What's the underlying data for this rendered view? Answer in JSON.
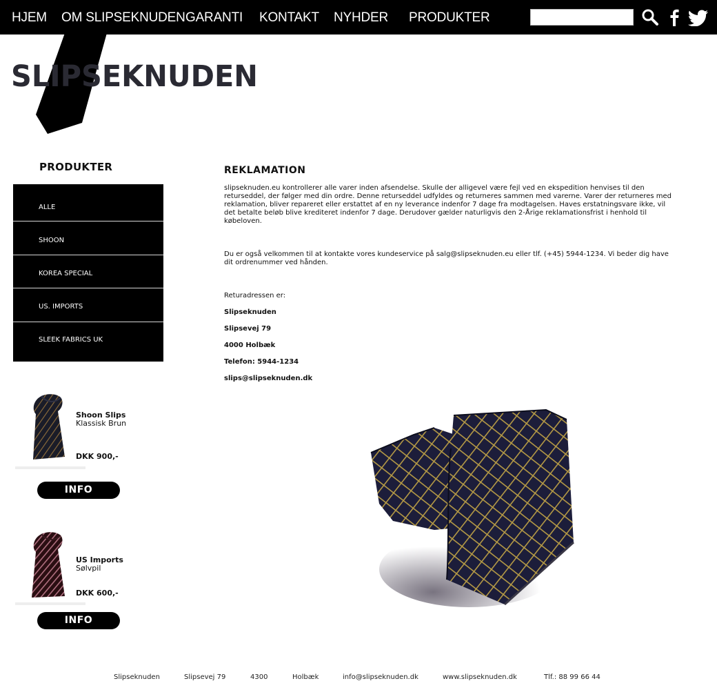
{
  "nav": {
    "items": [
      "HJEM",
      "OM SLIPSEKNUDEN",
      "GARANTI",
      "KONTAKT",
      "NYHDER",
      "PRODUKTER"
    ],
    "search_value": ""
  },
  "icons": {
    "search": "search-icon",
    "facebook": "facebook-icon",
    "twitter": "twitter-icon"
  },
  "logo": {
    "text": "SLIPSEKNUDEN"
  },
  "sidebar": {
    "heading": "PRODUKTER",
    "items": [
      "ALLE",
      "SHOON",
      "KOREA SPECIAL",
      "US. IMPORTS",
      "SLEEK FABRICS UK"
    ]
  },
  "products": [
    {
      "name": "Shoon Slips",
      "subtitle": "Klassisk Brun",
      "price": "DKK 900,-",
      "button": "INFO"
    },
    {
      "name": "US Imports",
      "subtitle": "Sølvpil",
      "price": "DKK 600,-",
      "button": "INFO"
    }
  ],
  "main": {
    "title": "REKLAMATION",
    "paragraph1": "slipseknuden.eu kontrollerer alle varer inden afsendelse. Skulle der alligevel være fejl ved en ekspedition henvises til den returseddel, der følger med din ordre. Denne returseddel udfyldes og returneres sammen med varerne. Varer der returneres med reklamation, bliver repareret eller erstattet af en ny leverance indenfor 7 dage fra modtagelsen. Haves erstatningsvare ikke, vil det betalte beløb blive krediteret indenfor 7 dage. Derudover gælder naturligvis den 2-Årige reklamationsfrist i henhold til købeloven.",
    "paragraph2": "Du er også velkommen til at kontakte vores kundeservice på salg@slipseknuden.eu eller tlf. (+45) 5944-1234. Vi beder dig have dit ordrenummer ved hånden.",
    "address_label": "Returadressen er:",
    "address_lines": [
      "Slipseknuden",
      "Slipsevej 79",
      "4000 Holbæk",
      "Telefon: 5944-1234",
      "slips@slipseknuden.dk"
    ]
  },
  "footer": {
    "items": [
      "Slipseknuden",
      "Slipsevej 79",
      "4300",
      "Holbæk",
      "info@slipseknuden.dk",
      "www.slipseknuden.dk",
      "Tlf.: 88 99 66 44"
    ]
  },
  "colors": {
    "nav_bg": "#000000",
    "nav_text": "#ffffff",
    "sidebar_bg": "#000000",
    "logo_text": "#2a2a33",
    "tie_navy": "#1c1d3a",
    "tie_gold": "#b59a45"
  }
}
